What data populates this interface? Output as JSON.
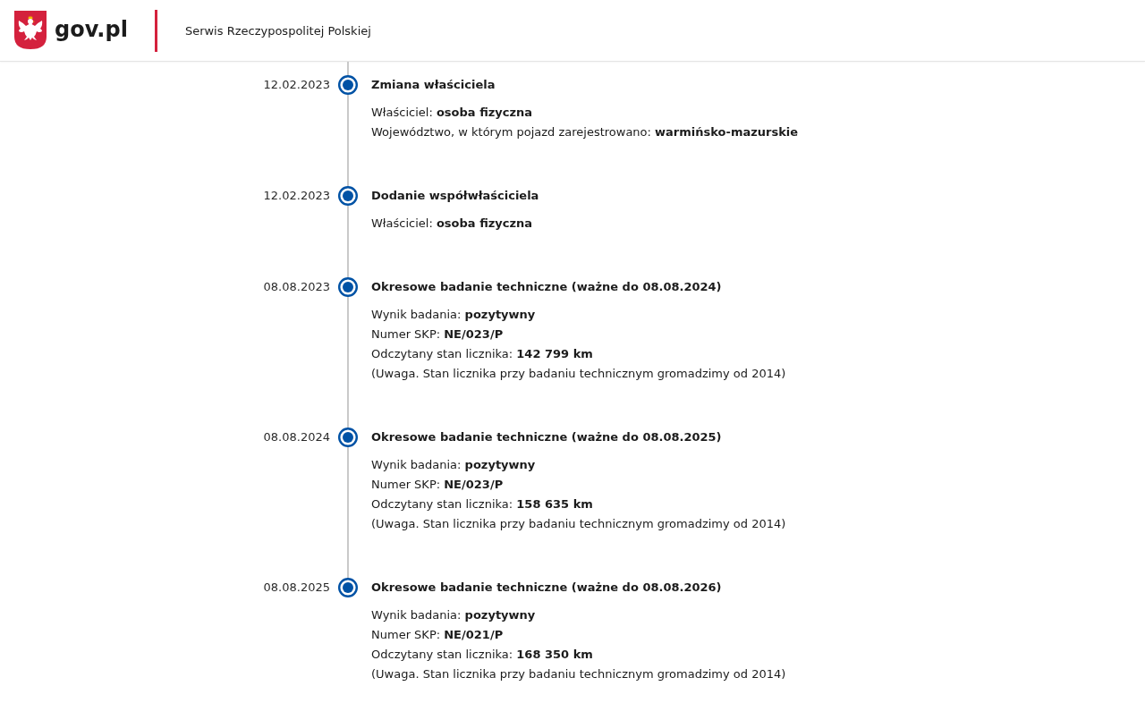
{
  "header": {
    "logo_text": "gov.pl",
    "service_name": "Serwis Rzeczypospolitej Polskiej"
  },
  "timeline": [
    {
      "date": "12.02.2023",
      "title": "Zmiana właściciela",
      "details": [
        "Właściciel: **osoba fizyczna**",
        "Województwo, w którym pojazd zarejestrowano: **warmińsko-mazurskie**"
      ]
    },
    {
      "date": "12.02.2023",
      "title": "Dodanie współwłaściciela",
      "details": [
        "Właściciel: **osoba fizyczna**"
      ]
    },
    {
      "date": "08.08.2023",
      "title": "Okresowe badanie techniczne (ważne do 08.08.2024)",
      "details": [
        "Wynik badania: **pozytywny**",
        "Numer SKP: **NE/023/P**",
        "Odczytany stan licznika: **142 799 km**",
        "(Uwaga. Stan licznika przy badaniu technicznym gromadzimy od 2014)"
      ]
    },
    {
      "date": "08.08.2024",
      "title": "Okresowe badanie techniczne (ważne do 08.08.2025)",
      "details": [
        "Wynik badania: **pozytywny**",
        "Numer SKP: **NE/023/P**",
        "Odczytany stan licznika: **158 635 km**",
        "(Uwaga. Stan licznika przy badaniu technicznym gromadzimy od 2014)"
      ]
    },
    {
      "date": "08.08.2025",
      "title": "Okresowe badanie techniczne (ważne do 08.08.2026)",
      "details": [
        "Wynik badania: **pozytywny**",
        "Numer SKP: **NE/021/P**",
        "Odczytany stan licznika: **168 350 km**",
        "(Uwaga. Stan licznika przy badaniu technicznym gromadzimy od 2014)"
      ]
    }
  ]
}
